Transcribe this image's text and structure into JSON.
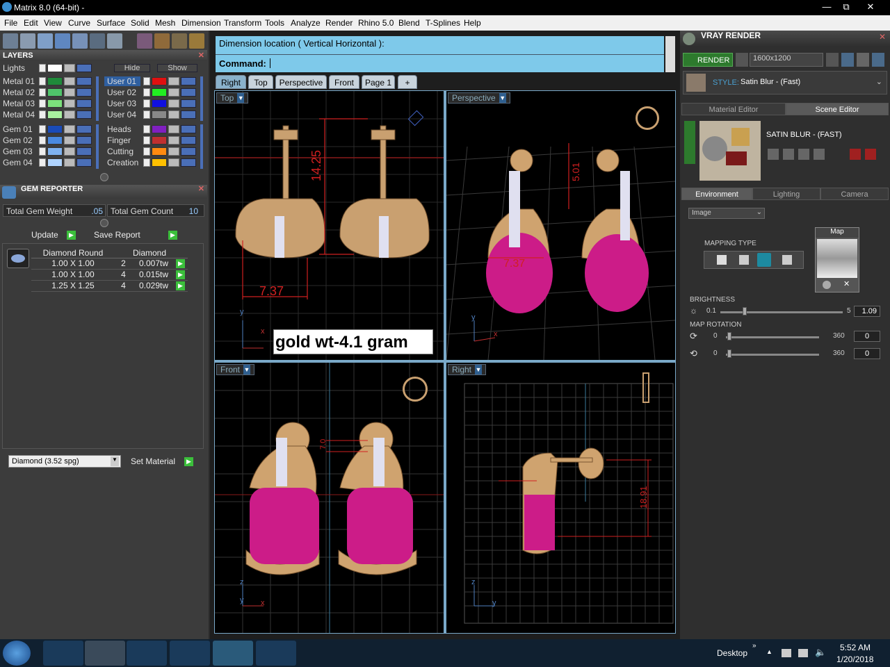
{
  "window": {
    "title": "Matrix 8.0 (64-bit) -",
    "controls": {
      "minimize": "—",
      "restore": "⧉",
      "close": "✕"
    }
  },
  "menu": [
    "File",
    "Edit",
    "View",
    "Curve",
    "Surface",
    "Solid",
    "Mesh",
    "Dimension",
    "Transform",
    "Tools",
    "Analyze",
    "Render",
    "Rhino 5.0",
    "Blend",
    "T-Splines",
    "Help"
  ],
  "layers": {
    "title": "LAYERS",
    "lights_label": "Lights",
    "hide_label": "Hide",
    "show_label": "Show",
    "left": [
      {
        "name": "Metal 01",
        "color": "#1f8a3a"
      },
      {
        "name": "Metal 02",
        "color": "#4fc46a"
      },
      {
        "name": "Metal 03",
        "color": "#7ce07c"
      },
      {
        "name": "Metal 04",
        "color": "#a8f0a0"
      },
      {
        "name": "Gem 01",
        "color": "#1a4bb8"
      },
      {
        "name": "Gem 02",
        "color": "#4a8ae0"
      },
      {
        "name": "Gem 03",
        "color": "#7fb2f0"
      },
      {
        "name": "Gem 04",
        "color": "#b0d4ff"
      }
    ],
    "right": [
      {
        "name": "User 01",
        "color": "#e01010"
      },
      {
        "name": "User 02",
        "color": "#22ee22"
      },
      {
        "name": "User 03",
        "color": "#1010e0"
      },
      {
        "name": "User 04",
        "color": "#888888"
      },
      {
        "name": "Heads",
        "color": "#8020c0"
      },
      {
        "name": "Finger",
        "color": "#c03030"
      },
      {
        "name": "Cutting",
        "color": "#ff8a10"
      },
      {
        "name": "Creation",
        "color": "#ffc000"
      }
    ]
  },
  "gem_reporter": {
    "title": "GEM REPORTER",
    "total_weight_label": "Total Gem Weight",
    "total_weight": ".05",
    "total_count_label": "Total Gem Count",
    "total_count": "10",
    "update_label": "Update",
    "save_label": "Save Report",
    "columns": [
      "Diamond Round",
      "Diamond"
    ],
    "rows": [
      {
        "size": "1.00 X 1.00",
        "qty": "2",
        "weight": "0.007tw"
      },
      {
        "size": "1.00 X 1.00",
        "qty": "4",
        "weight": "0.015tw"
      },
      {
        "size": "1.25 X 1.25",
        "qty": "4",
        "weight": "0.029tw"
      }
    ],
    "material_select": "Diamond    (3.52 spg)",
    "set_material_label": "Set Material"
  },
  "command": {
    "prompt_line": "Dimension location ( Vertical  Horizontal ):",
    "command_label": "Command:"
  },
  "view_tabs": [
    "Right",
    "Top",
    "Perspective",
    "Front",
    "Page 1"
  ],
  "add_tab": "+",
  "viewports": {
    "top": {
      "label": "Top",
      "dim_width": "7.37",
      "dim_height": "14.25"
    },
    "perspective": {
      "label": "Perspective",
      "dim_width": "7.37",
      "dim_height": "5.01"
    },
    "front": {
      "label": "Front",
      "dim": "7.0"
    },
    "right": {
      "label": "Right",
      "dim": "18.91"
    }
  },
  "annotation": "gold wt-4.1 gram",
  "axes": {
    "x": "x",
    "y": "y",
    "z": "z"
  },
  "vray": {
    "title": "VRAY RENDER",
    "render_label": "RENDER",
    "resolution": "1600x1200",
    "style_label": "STYLE:",
    "style_value": "Satin Blur - (Fast)",
    "tabs": [
      "Material Editor",
      "Scene Editor"
    ],
    "scene_name": "SATIN BLUR - (FAST)",
    "env_tabs": [
      "Environment",
      "Lighting",
      "Camera"
    ],
    "env_source": "Image",
    "map_label": "Map",
    "mapping_type_label": "MAPPING TYPE",
    "brightness_label": "BRIGHTNESS",
    "brightness_min": "0.1",
    "brightness_max": "5",
    "brightness_value": "1.09",
    "map_rotation_label": "MAP ROTATION",
    "rot1_min": "0",
    "rot1_max": "360",
    "rot1_value": "0",
    "rot2_min": "0",
    "rot2_max": "360",
    "rot2_value": "0"
  },
  "taskbar": {
    "desktop_label": "Desktop",
    "time": "5:52 AM",
    "date": "1/20/2018"
  }
}
